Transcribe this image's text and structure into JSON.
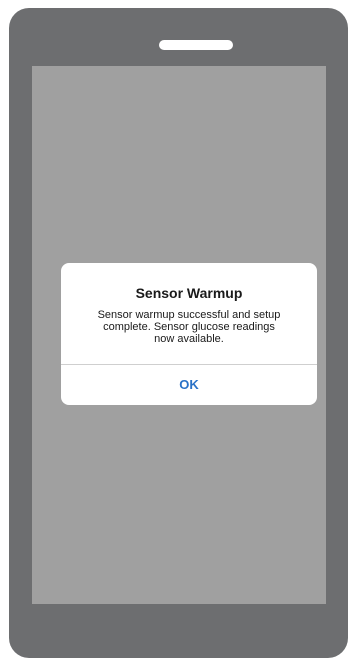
{
  "alert": {
    "title": "Sensor Warmup",
    "message_lines": [
      "Sensor warmup successful and setup",
      "complete. Sensor glucose readings",
      "now available."
    ],
    "ok_label": "OK"
  },
  "colors": {
    "phone_body": "#6d6e70",
    "screen": "#a0a0a0",
    "dialog_background": "#ffffff",
    "ok_button_text": "#2a72c7"
  }
}
